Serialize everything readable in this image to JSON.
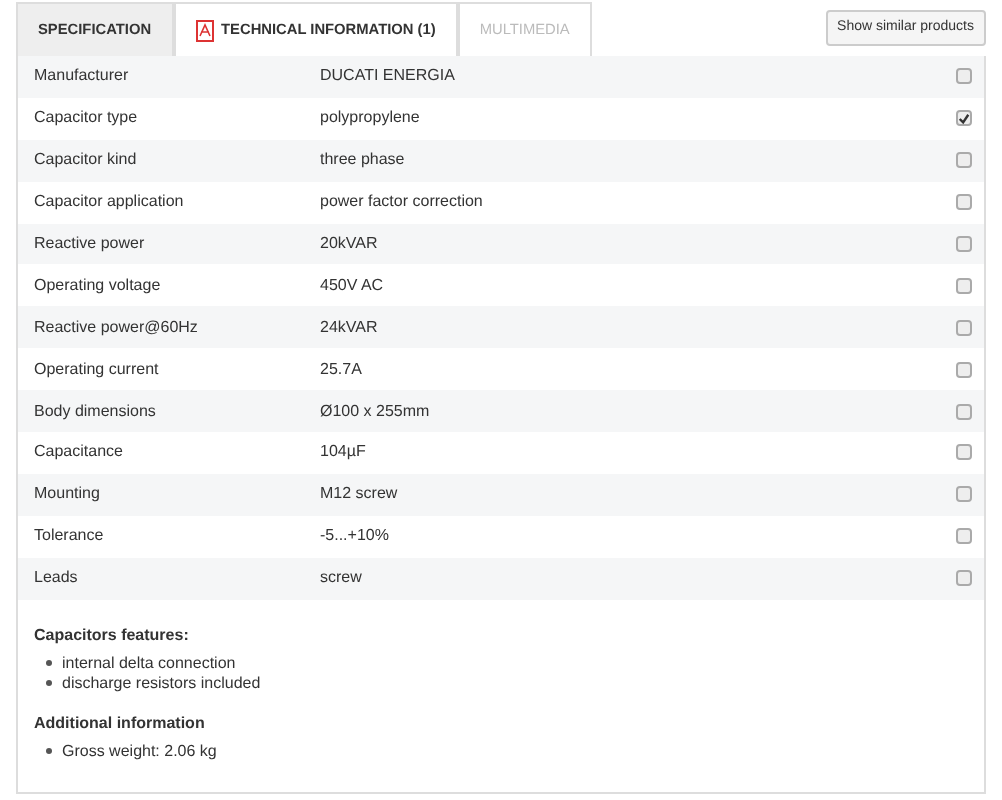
{
  "tabs": [
    {
      "label": "SPECIFICATION",
      "selected": true,
      "kind": "text"
    },
    {
      "label": "TECHNICAL INFORMATION (1)",
      "selected": false,
      "kind": "pdf"
    },
    {
      "label": "MULTIMEDIA",
      "selected": false,
      "kind": "disabled"
    }
  ],
  "similar_button": "Show similar products",
  "specs": [
    {
      "name": "Manufacturer",
      "value": "DUCATI ENERGIA",
      "checked": false
    },
    {
      "name": "Capacitor type",
      "value": "polypropylene",
      "checked": true
    },
    {
      "name": "Capacitor kind",
      "value": "three phase",
      "checked": false
    },
    {
      "name": "Capacitor application",
      "value": "power factor correction",
      "checked": false
    },
    {
      "name": "Reactive power",
      "value": "20kVAR",
      "checked": false
    },
    {
      "name": "Operating voltage",
      "value": "450V AC",
      "checked": false
    },
    {
      "name": "Reactive power@60Hz",
      "value": "24kVAR",
      "checked": false
    },
    {
      "name": "Operating current",
      "value": "25.7A",
      "checked": false
    },
    {
      "name": "Body dimensions",
      "value": "Ø100 x 255mm",
      "checked": false
    },
    {
      "name": "Capacitance",
      "value": "104µF",
      "checked": false
    },
    {
      "name": "Mounting",
      "value": "M12 screw",
      "checked": false
    },
    {
      "name": "Tolerance",
      "value": "-5...+10%",
      "checked": false
    },
    {
      "name": "Leads",
      "value": "screw",
      "checked": false
    }
  ],
  "sections": [
    {
      "heading": "Capacitors features:",
      "items": [
        "internal delta connection",
        "discharge resistors included"
      ]
    },
    {
      "heading": "Additional information",
      "items": [
        "Gross weight: 2.06 kg"
      ]
    }
  ]
}
